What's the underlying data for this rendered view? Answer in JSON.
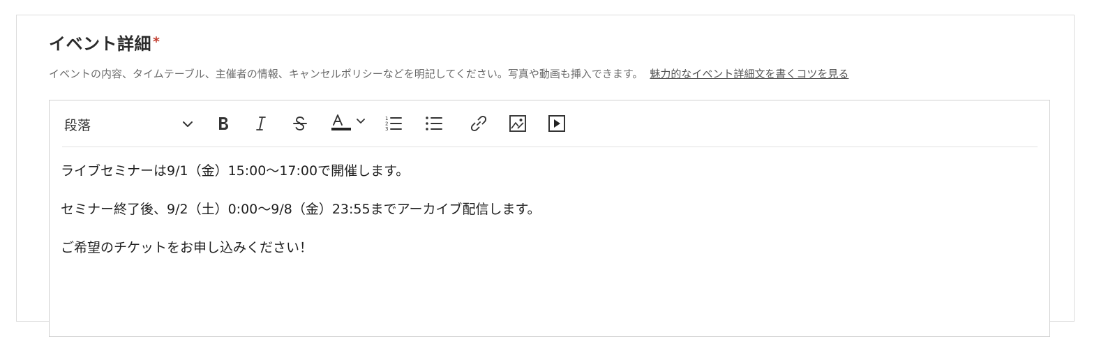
{
  "section": {
    "title": "イベント詳細",
    "required_mark": "*",
    "help_text": "イベントの内容、タイムテーブル、主催者の情報、キャンセルポリシーなどを明記してください。写真や動画も挿入できます。",
    "help_link": "魅力的なイベント詳細文を書くコツを見る"
  },
  "toolbar": {
    "block_format": "段落",
    "buttons": [
      {
        "name": "bold",
        "icon": "bold-icon"
      },
      {
        "name": "italic",
        "icon": "italic-icon"
      },
      {
        "name": "strikethrough",
        "icon": "strikethrough-icon"
      },
      {
        "name": "text-color",
        "icon": "text-color-icon"
      },
      {
        "name": "numbered-list",
        "icon": "numbered-list-icon"
      },
      {
        "name": "bulleted-list",
        "icon": "bulleted-list-icon"
      },
      {
        "name": "link",
        "icon": "link-icon"
      },
      {
        "name": "image",
        "icon": "image-icon"
      },
      {
        "name": "video",
        "icon": "video-icon"
      }
    ]
  },
  "editor": {
    "paragraphs": [
      "ライブセミナーは9/1（金）15:00〜17:00で開催します。",
      "セミナー終了後、9/2（土）0:00〜9/8（金）23:55までアーカイブ配信します。",
      "ご希望のチケットをお申し込みください！"
    ]
  },
  "colors": {
    "required": "#c0392b",
    "border": "#dcdcdc",
    "text": "#222222"
  }
}
